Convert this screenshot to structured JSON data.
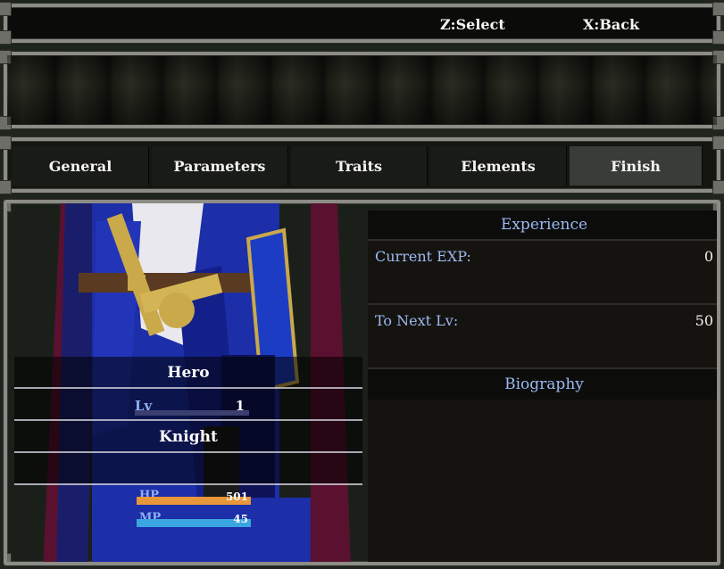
{
  "help": {
    "select": "Z:Select",
    "back": "X:Back"
  },
  "tabs": [
    "General",
    "Parameters",
    "Traits",
    "Elements",
    "Finish"
  ],
  "active_tab": "Finish",
  "actor": {
    "name": "Hero",
    "level_label": "Lv",
    "level": "1",
    "class": "Knight",
    "hp_label": "HP",
    "hp": "501",
    "hp_fraction": 1.0,
    "mp_label": "MP",
    "mp": "45",
    "mp_fraction": 1.0
  },
  "experience": {
    "header": "Experience",
    "current_label": "Current EXP:",
    "current_value": "0",
    "next_label": "To Next Lv:",
    "next_value": "50"
  },
  "biography": {
    "header": "Biography",
    "text": ""
  },
  "colors": {
    "hp": "#e8963a",
    "mp": "#3aa6e0",
    "label_blue": "#9dbaf2"
  }
}
